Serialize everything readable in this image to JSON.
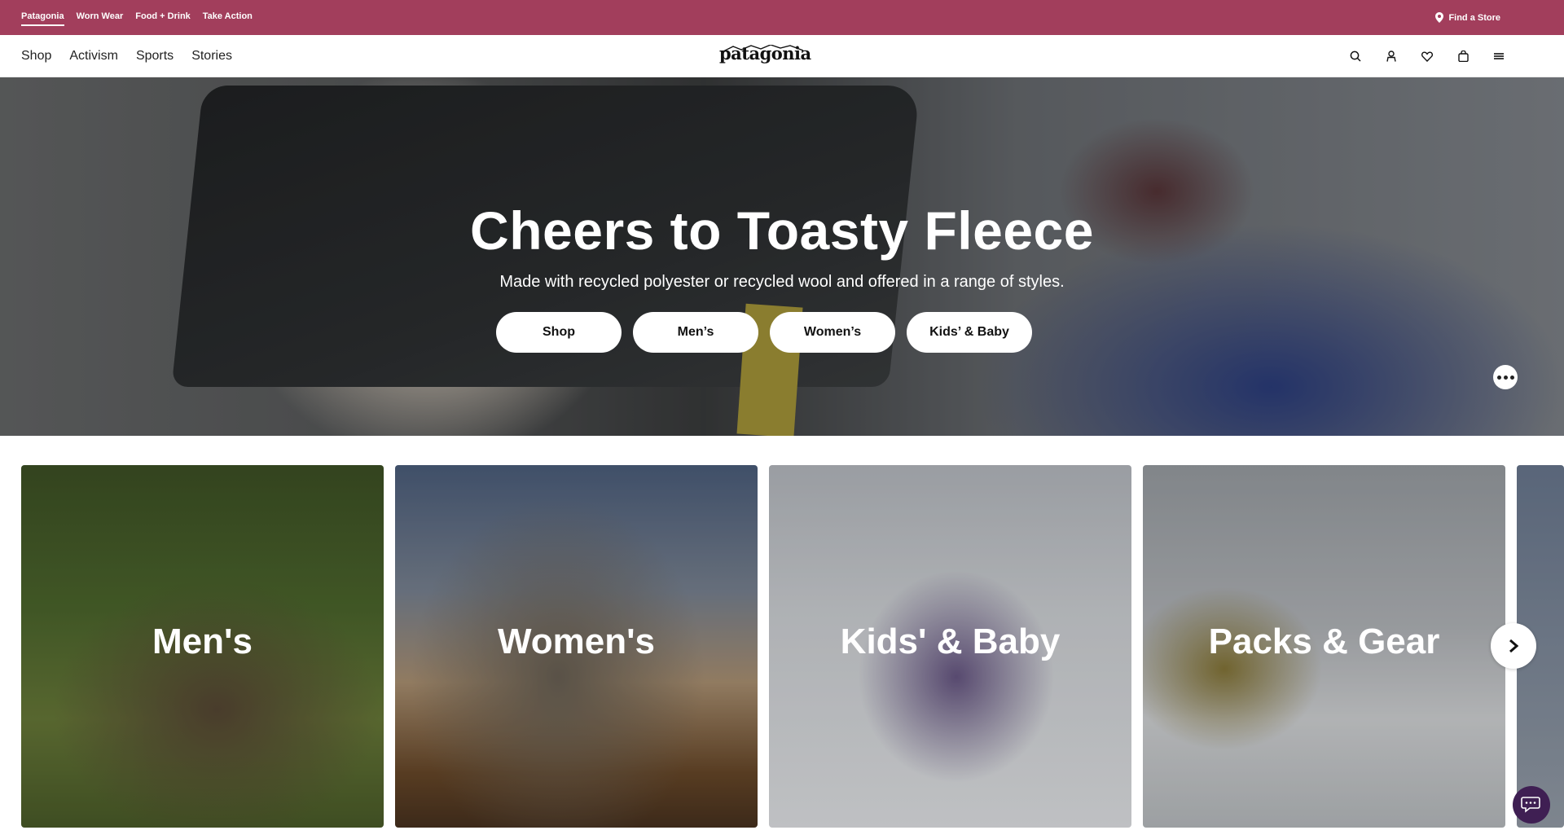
{
  "utility_bar": {
    "links": [
      {
        "label": "Patagonia",
        "active": true
      },
      {
        "label": "Worn Wear",
        "active": false
      },
      {
        "label": "Food + Drink",
        "active": false
      },
      {
        "label": "Take Action",
        "active": false
      }
    ],
    "find_store": "Find a Store",
    "background": "#a23e5c"
  },
  "main_nav": {
    "items": [
      "Shop",
      "Activism",
      "Sports",
      "Stories"
    ],
    "logo": "patagonia",
    "icons": [
      "search-icon",
      "account-icon",
      "wishlist-icon",
      "bag-icon",
      "menu-icon"
    ]
  },
  "hero": {
    "title": "Cheers to Toasty Fleece",
    "subtitle": "Made with recycled polyester or recycled wool and offered in a range of styles.",
    "buttons": [
      "Shop",
      "Men’s",
      "Women’s",
      "Kids’ & Baby"
    ]
  },
  "categories": [
    {
      "label": "Men's"
    },
    {
      "label": "Women's"
    },
    {
      "label": "Kids' & Baby"
    },
    {
      "label": "Packs & Gear"
    }
  ]
}
